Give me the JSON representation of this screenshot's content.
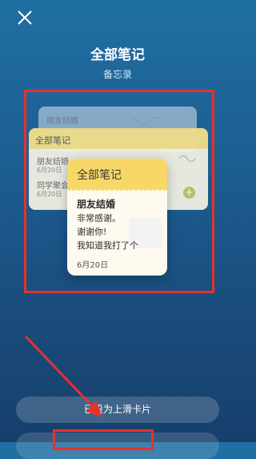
{
  "header": {
    "title": "全部笔记",
    "subtitle": "备忘录"
  },
  "preview": {
    "back_card": {
      "title": "朋友结婚"
    },
    "mid_card": {
      "header": "全部笔记",
      "rows": [
        {
          "title": "朋友结婚",
          "date": "6月20日"
        },
        {
          "title": "同学聚会",
          "date": "6月20日"
        }
      ]
    },
    "front_card": {
      "header": "全部笔记",
      "note_title": "朋友结婚",
      "lines": [
        "非常感谢。",
        "谢谢你!",
        "我知道我打了个"
      ],
      "date": "6月20日"
    }
  },
  "actions": {
    "set_label": "已设为上滑卡片"
  },
  "annotations": {
    "highlight_color": "#e5322d"
  },
  "icons": {
    "close": "close-icon",
    "plus": "plus-icon"
  }
}
